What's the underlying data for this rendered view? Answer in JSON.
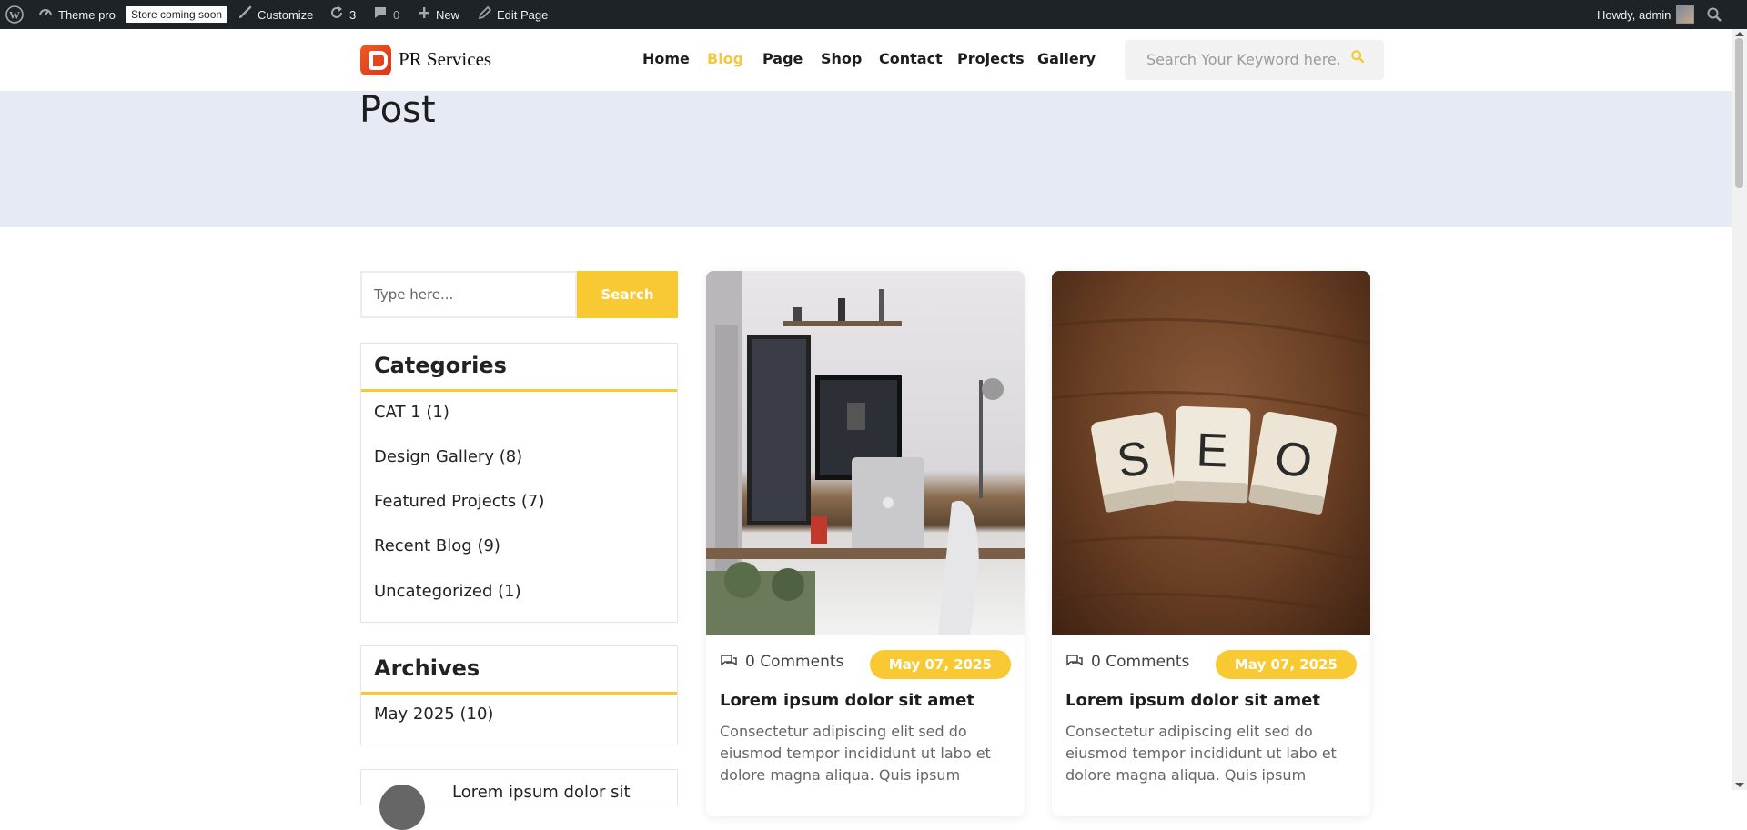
{
  "admin_bar": {
    "site_name": "Theme pro",
    "store_badge": "Store coming soon",
    "customize": "Customize",
    "updates_count": "3",
    "comments_count": "0",
    "new_label": "New",
    "edit_page": "Edit Page",
    "howdy": "Howdy, admin"
  },
  "header": {
    "logo_text": "PR Services",
    "nav": [
      "Home",
      "Blog",
      "Page",
      "Shop",
      "Contact",
      "Projects",
      "Gallery"
    ],
    "active_nav": "Blog",
    "search_placeholder": "Search Your Keyword here."
  },
  "banner": {
    "title": "Post"
  },
  "sidebar": {
    "search_placeholder": "Type here...",
    "search_button": "Search",
    "categories": {
      "title": "Categories",
      "items": [
        "CAT 1 (1)",
        "Design Gallery (8)",
        "Featured Projects (7)",
        "Recent Blog (9)",
        "Uncategorized (1)"
      ]
    },
    "archives": {
      "title": "Archives",
      "items": [
        "May 2025 (10)"
      ]
    },
    "recent_post_partial": "Lorem ipsum dolor sit"
  },
  "posts": [
    {
      "comments": "0 Comments",
      "date": "May  07, 2025",
      "title": "Lorem ipsum dolor sit amet",
      "excerpt": "Consectetur adipiscing elit sed do eiusmod tempor incididunt ut labo et dolore magna aliqua. Quis ipsum"
    },
    {
      "comments": "0 Comments",
      "date": "May  07, 2025",
      "title": "Lorem ipsum dolor sit amet",
      "excerpt": "Consectetur adipiscing elit sed do eiusmod tempor incididunt ut labo et dolore magna aliqua. Quis ipsum"
    }
  ],
  "colors": {
    "accent": "#f9c933",
    "admin_bar": "#1d2327",
    "banner_bg": "#e5eaf4",
    "logo": "#f15a24"
  },
  "icons": {
    "wp_logo": "wordpress-icon",
    "dashboard": "speedometer-icon",
    "customize": "brush-icon",
    "updates": "refresh-icon",
    "comments": "speech-bubble-icon",
    "new": "plus-icon",
    "edit": "pencil-icon",
    "search": "magnifier-icon"
  }
}
